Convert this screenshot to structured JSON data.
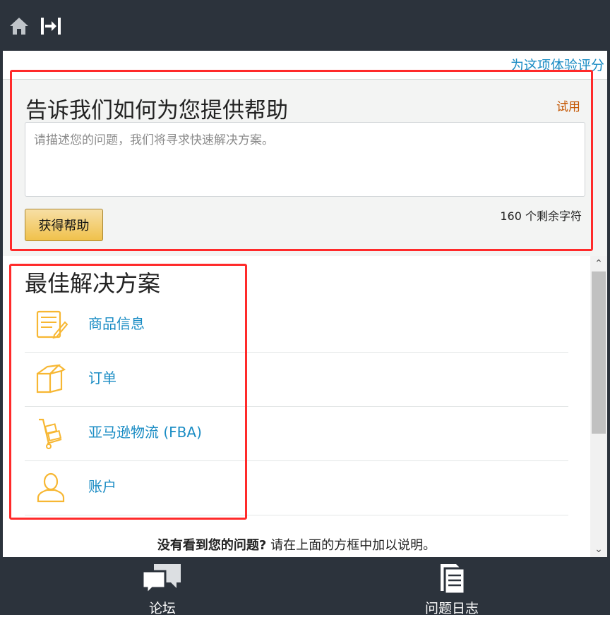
{
  "header": {
    "home_icon": "home-icon",
    "collapse_icon": "collapse-arrow-icon"
  },
  "rate_link": "为这项体验评分",
  "help": {
    "title": "告诉我们如何为您提供帮助",
    "try_label": "试用",
    "placeholder": "请描述您的问题，我们将寻求快速解决方案。",
    "value": "",
    "button": "获得帮助",
    "char_count": "160 个剩余字符"
  },
  "solutions": {
    "title": "最佳解决方案",
    "items": [
      {
        "label": "商品信息",
        "icon": "product-info-icon"
      },
      {
        "label": "订单",
        "icon": "order-box-icon"
      },
      {
        "label": "亚马逊物流 (FBA)",
        "icon": "fba-cart-icon"
      },
      {
        "label": "账户",
        "icon": "account-user-icon"
      }
    ],
    "not_seen_bold": "没有看到您的问题?",
    "not_seen_rest": "请在上面的方框中加以说明。"
  },
  "footer": {
    "tabs": [
      {
        "label": "论坛",
        "icon": "forum-chat-icon"
      },
      {
        "label": "问题日志",
        "icon": "issue-log-icon"
      }
    ]
  },
  "colors": {
    "dark_bar": "#2c333c",
    "link": "#1a8cc4",
    "accent_orange": "#c45500",
    "button_gold": "#f0c14b",
    "highlight_red": "#ff2a2a",
    "icon_orange": "#f7b733"
  }
}
